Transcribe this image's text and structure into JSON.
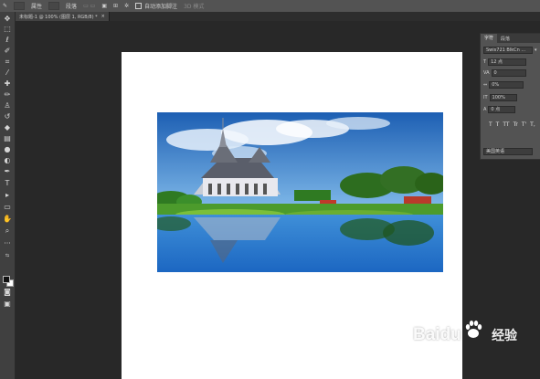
{
  "options_bar": {
    "items": [
      "",
      "属性",
      "段落",
      "",
      "",
      "",
      "",
      "",
      "",
      "",
      "自动添加脚注",
      "",
      ""
    ],
    "checkbox_label": "自动添加脚注",
    "dim_label": "3D 模式"
  },
  "document_tab": {
    "title": "未标题-1 @ 100% (图层 1, RGB/8) *",
    "close": "×"
  },
  "toolbox": {
    "tools": [
      "move-tool",
      "marquee-tool",
      "lasso-tool",
      "quick-select-tool",
      "crop-tool",
      "eyedropper-tool",
      "healing-tool",
      "brush-tool",
      "stamp-tool",
      "history-brush-tool",
      "eraser-tool",
      "gradient-tool",
      "blur-tool",
      "dodge-tool",
      "pen-tool",
      "type-tool",
      "path-select-tool",
      "shape-tool",
      "hand-tool",
      "zoom-tool",
      "more-tool"
    ]
  },
  "character_panel": {
    "tab_active": "字符",
    "tab_other": "段落",
    "font_family": "Swis721 BlkCn ...",
    "font_size": "12 点",
    "leading": "0",
    "tracking": "0%",
    "scale": "100%",
    "baseline": "0 点",
    "language": "美国英语",
    "style_buttons": [
      "T",
      "T",
      "TT",
      "Tr",
      "T'",
      "T,",
      "T",
      "T"
    ]
  },
  "watermark": {
    "text": "Baidu",
    "sub": "经验"
  },
  "colors": {
    "app_bg": "#282828",
    "panel": "#535353",
    "toolbar": "#404040",
    "canvas": "#ffffff"
  }
}
